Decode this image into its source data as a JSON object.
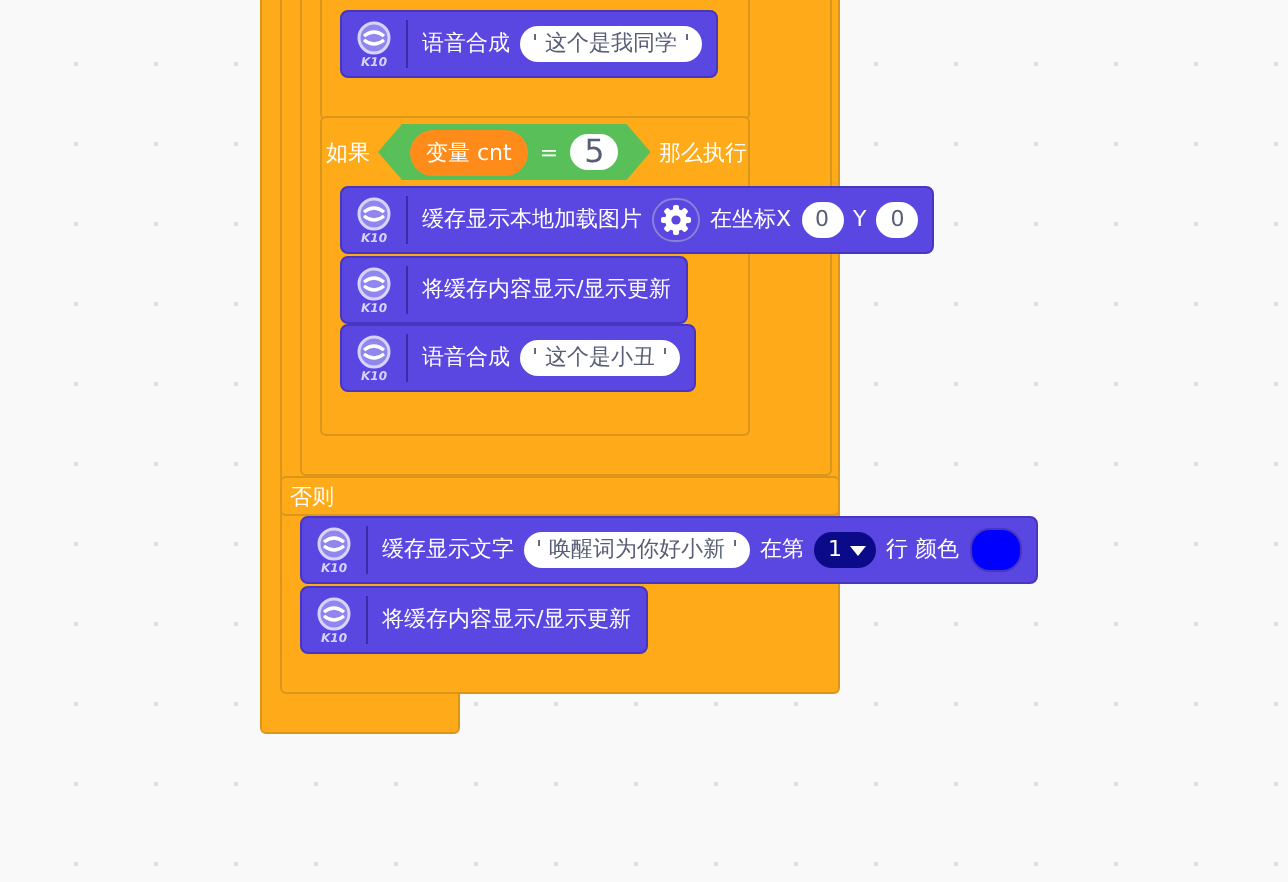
{
  "script": [
    {
      "kind": "statement",
      "badge": "K10",
      "parts": [
        {
          "kind": "text",
          "text": "语音合成"
        },
        {
          "kind": "string",
          "text": "' 这个是我同学 '"
        }
      ]
    },
    {
      "kind": "if",
      "label": "如果",
      "variable": "变量 cnt",
      "operator": "=",
      "value": "5",
      "then_label": "那么执行"
    },
    {
      "kind": "statement",
      "badge": "K10",
      "parts": [
        {
          "kind": "text",
          "text": "缓存显示本地加载图片"
        },
        {
          "kind": "image"
        },
        {
          "kind": "text",
          "text": "在坐标X"
        },
        {
          "kind": "number",
          "text": "0"
        },
        {
          "kind": "text",
          "text": "Y"
        },
        {
          "kind": "number",
          "text": "0"
        }
      ]
    },
    {
      "kind": "statement",
      "badge": "K10",
      "parts": [
        {
          "kind": "text",
          "text": "将缓存内容显示/显示更新"
        }
      ]
    },
    {
      "kind": "statement",
      "badge": "K10",
      "parts": [
        {
          "kind": "text",
          "text": "语音合成"
        },
        {
          "kind": "string",
          "text": "' 这个是小丑 '"
        }
      ]
    },
    {
      "kind": "else",
      "label": "否则"
    },
    {
      "kind": "statement",
      "badge": "K10",
      "parts": [
        {
          "kind": "text",
          "text": "缓存显示文字"
        },
        {
          "kind": "string",
          "text": "' 唤醒词为你好小新 '"
        },
        {
          "kind": "text",
          "text": "在第"
        },
        {
          "kind": "dropdown",
          "text": "1"
        },
        {
          "kind": "text",
          "text": "行 颜色"
        },
        {
          "kind": "color",
          "color": "#0000ff"
        }
      ]
    },
    {
      "kind": "statement",
      "badge": "K10",
      "parts": [
        {
          "kind": "text",
          "text": "将缓存内容显示/显示更新"
        }
      ]
    }
  ]
}
